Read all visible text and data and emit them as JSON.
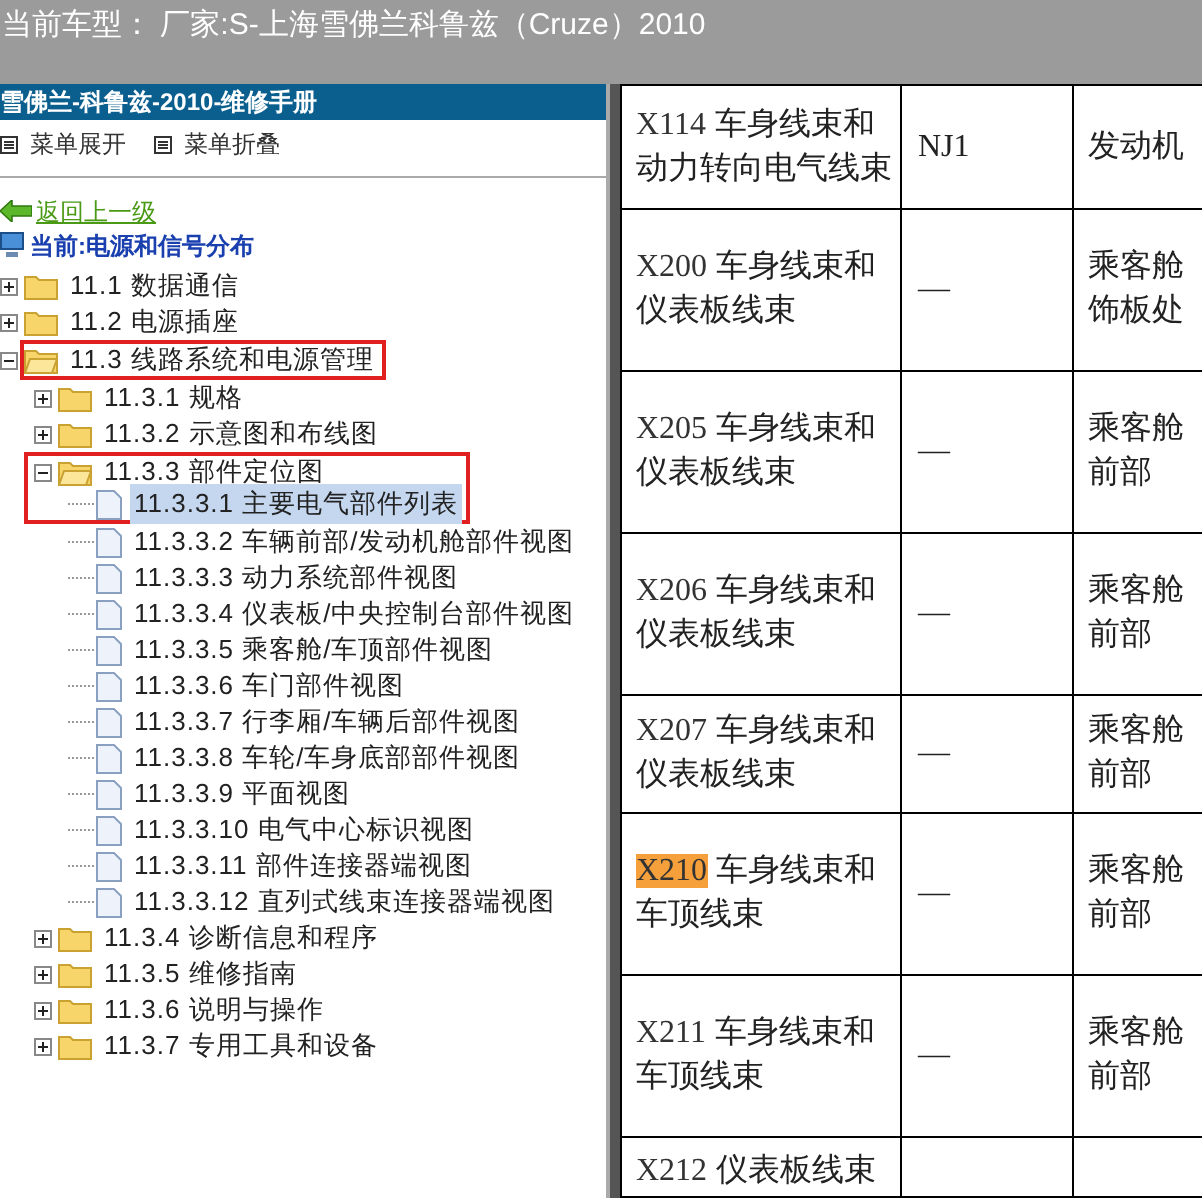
{
  "window": {
    "title": "当前车型： 厂家:S-上海雪佛兰科鲁兹（Cruze）2010"
  },
  "manual": {
    "title": "雪佛兰-科鲁兹-2010-维修手册",
    "toolbar": [
      {
        "label": "菜单展开"
      },
      {
        "label": "菜单折叠"
      }
    ],
    "back_link": "返回上一级",
    "current": "当前:电源和信号分布",
    "tree": [
      {
        "kind": "folder",
        "label": "11.1 数据通信",
        "expanded": false,
        "outlined": false
      },
      {
        "kind": "folder",
        "label": "11.2 电源插座",
        "expanded": false,
        "outlined": false
      },
      {
        "kind": "folder",
        "label": "11.3 线路系统和电源管理",
        "expanded": true,
        "outlined": true,
        "children": [
          {
            "kind": "folder",
            "label": "11.3.1 规格",
            "expanded": false,
            "outlined": false
          },
          {
            "kind": "folder",
            "label": "11.3.2 示意图和布线图",
            "expanded": false,
            "outlined": false
          },
          {
            "kind": "folder",
            "label": "11.3.3 部件定位图",
            "expanded": true,
            "outlined": true,
            "children": [
              {
                "kind": "page",
                "label": "11.3.3.1 主要电气部件列表",
                "selected": true,
                "outlined": true
              },
              {
                "kind": "page",
                "label": "11.3.3.2 车辆前部/发动机舱部件视图",
                "selected": false,
                "outlined": false
              },
              {
                "kind": "page",
                "label": "11.3.3.3 动力系统部件视图",
                "selected": false,
                "outlined": false
              },
              {
                "kind": "page",
                "label": "11.3.3.4 仪表板/中央控制台部件视图",
                "selected": false,
                "outlined": false
              },
              {
                "kind": "page",
                "label": "11.3.3.5 乘客舱/车顶部件视图",
                "selected": false,
                "outlined": false
              },
              {
                "kind": "page",
                "label": "11.3.3.6 车门部件视图",
                "selected": false,
                "outlined": false
              },
              {
                "kind": "page",
                "label": "11.3.3.7 行李厢/车辆后部件视图",
                "selected": false,
                "outlined": false
              },
              {
                "kind": "page",
                "label": "11.3.3.8 车轮/车身底部部件视图",
                "selected": false,
                "outlined": false
              },
              {
                "kind": "page",
                "label": "11.3.3.9 平面视图",
                "selected": false,
                "outlined": false
              },
              {
                "kind": "page",
                "label": "11.3.3.10 电气中心标识视图",
                "selected": false,
                "outlined": false
              },
              {
                "kind": "page",
                "label": "11.3.3.11 部件连接器端视图",
                "selected": false,
                "outlined": false
              },
              {
                "kind": "page",
                "label": "11.3.3.12 直列式线束连接器端视图",
                "selected": false,
                "outlined": false
              }
            ]
          },
          {
            "kind": "folder",
            "label": "11.3.4 诊断信息和程序",
            "expanded": false,
            "outlined": false
          },
          {
            "kind": "folder",
            "label": "11.3.5 维修指南",
            "expanded": false,
            "outlined": false
          },
          {
            "kind": "folder",
            "label": "11.3.6 说明与操作",
            "expanded": false,
            "outlined": false
          },
          {
            "kind": "folder",
            "label": "11.3.7 专用工具和设备",
            "expanded": false,
            "outlined": false
          }
        ]
      }
    ]
  },
  "table": {
    "rows": [
      {
        "code": "X114",
        "name": [
          "车身线束和",
          "动力转向电气线束"
        ],
        "column_2": "NJ1",
        "column_3": [
          "发动机"
        ],
        "highlighted": false
      },
      {
        "code": "X200",
        "name": [
          "车身线束和",
          "仪表板线束"
        ],
        "column_2": "—",
        "column_3": [
          "乘客舱",
          "饰板处"
        ],
        "highlighted": false
      },
      {
        "code": "X205",
        "name": [
          "车身线束和",
          "仪表板线束"
        ],
        "column_2": "—",
        "column_3": [
          "乘客舱",
          "前部"
        ],
        "highlighted": false
      },
      {
        "code": "X206",
        "name": [
          "车身线束和",
          "仪表板线束"
        ],
        "column_2": "—",
        "column_3": [
          "乘客舱",
          "前部"
        ],
        "highlighted": false
      },
      {
        "code": "X207",
        "name": [
          "车身线束和",
          "仪表板线束"
        ],
        "column_2": "—",
        "column_3": [
          "乘客舱",
          "前部"
        ],
        "highlighted": false
      },
      {
        "code": "X210",
        "name": [
          "车身线束和",
          "车顶线束"
        ],
        "column_2": "—",
        "column_3": [
          "乘客舱",
          "前部"
        ],
        "highlighted": true
      },
      {
        "code": "X211",
        "name": [
          "车身线束和",
          "车顶线束"
        ],
        "column_2": "—",
        "column_3": [
          "乘客舱",
          "前部"
        ],
        "highlighted": false
      },
      {
        "code": "X212",
        "name": [
          "仪表板线束"
        ],
        "column_2": "",
        "column_3": [],
        "highlighted": false
      }
    ]
  }
}
